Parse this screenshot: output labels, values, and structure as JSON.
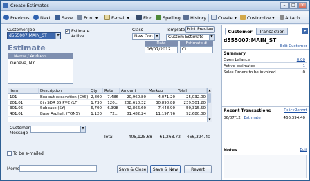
{
  "window": {
    "title": "Create Estimates"
  },
  "toolbar": {
    "previous": "Previous",
    "next": "Next",
    "save": "Save",
    "print": "Print",
    "email": "E-mail",
    "find": "Find",
    "spelling": "Spelling",
    "history": "History",
    "create": "Create",
    "customize": "Customize",
    "attach": "Attach"
  },
  "form": {
    "customer_job_label": "Customer:Job",
    "customer_job_value": "d555007:MAIN_ST",
    "estimate_active_label": "Estimate Active",
    "class_label": "Class",
    "class_value": "New Con...",
    "template_label": "Template",
    "print_preview": "Print Preview",
    "template_value": "Custom Estimate",
    "title": "Estimate",
    "date_label": "Date",
    "date_value": "06/07/2012",
    "estimate_no_label": "Estimate #",
    "estimate_no_value": "CLI",
    "name_address_label": "Name / Address",
    "name_address_value": "Geneva, NY"
  },
  "table": {
    "columns": [
      "Item",
      "Description",
      "Qty",
      "Rate",
      "Amount",
      "Markup",
      "Total"
    ],
    "rows": [
      [
        "101",
        "Box out excavation (CYS)",
        "2,800",
        "7.486",
        "20,960.80",
        "4,071.20",
        "25,032.00"
      ],
      [
        "201.01",
        "8in SDR 35 PVC (LF)",
        "1,730",
        "120...",
        "208,610.32",
        "30,890.88",
        "239,501.20"
      ],
      [
        "301.05",
        "Subbase (SY)",
        "6,700",
        "6.398",
        "42,866.60",
        "7,448.90",
        "50,315.50"
      ],
      [
        "401.01",
        "Base Asphalt (TONS)",
        "1,120",
        "72...",
        "81,482.24",
        "11,197.76",
        "92,680.00"
      ]
    ]
  },
  "footer": {
    "customer_message_label": "Customer Message",
    "total_label": "Total",
    "total_amount": "405,125.68",
    "total_markup": "61,268.72",
    "total_total": "466,394.40",
    "to_be_emailed": "To be e-mailed",
    "memo_label": "Memo",
    "save_close": "Save & Close",
    "save_new": "Save & New",
    "revert": "Revert"
  },
  "sidepanel": {
    "tab_customer": "Customer",
    "tab_transaction": "Transaction",
    "customer_name": "d555007:MAIN_ST",
    "edit_customer": "Edit Customer",
    "summary_title": "Summary",
    "summary_rows": [
      {
        "label": "Open balance",
        "value": "0.00"
      },
      {
        "label": "Active estimates",
        "value": "1"
      },
      {
        "label": "Sales Orders to be invoiced",
        "value": "0"
      }
    ],
    "recent_title": "Recent Transactions",
    "quick_report": "QuickReport",
    "recent_row": {
      "date": "06/07/12",
      "type": "Estimate",
      "amount": "466,394.40"
    },
    "notes_title": "Notes",
    "notes_edit": "Edit"
  },
  "colors": {
    "accent": "#6b7fa6",
    "link": "#1c4fa1",
    "titlebar": "#b9cee8"
  }
}
